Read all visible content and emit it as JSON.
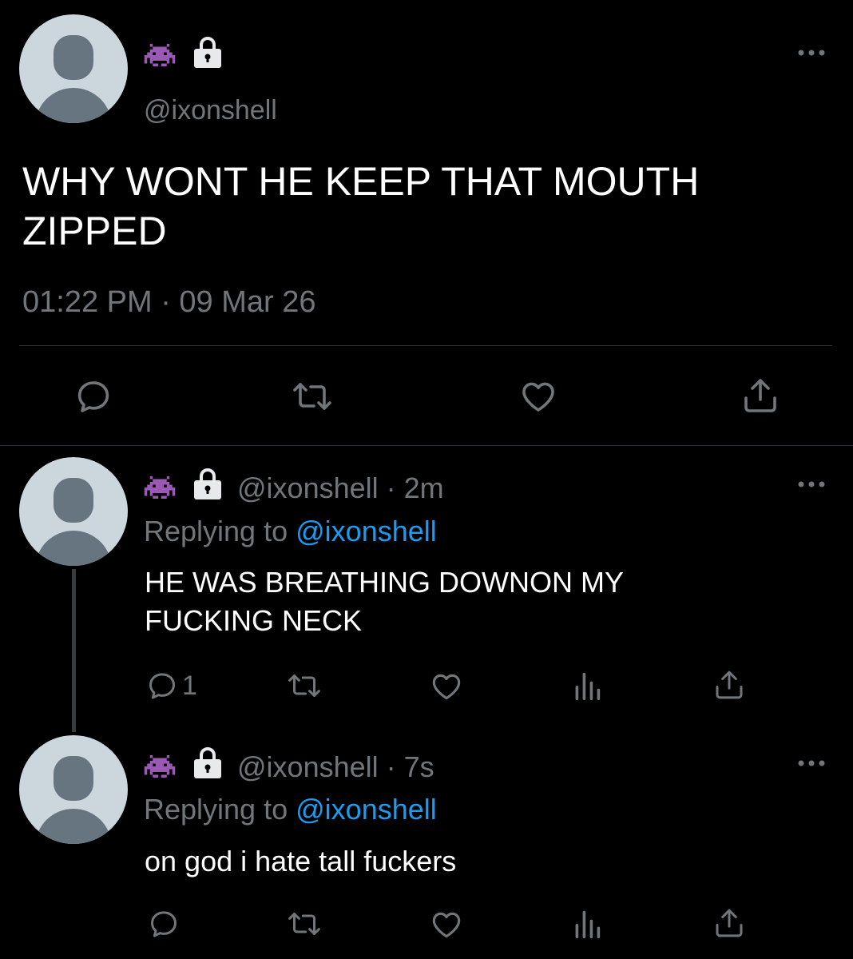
{
  "main_tweet": {
    "handle": "@ixonshell",
    "text_line1": "WHY WONT HE KEEP THAT MOUTH",
    "text_line2": "ZIPPED",
    "timestamp": "01:22 PM · 09 Mar 26"
  },
  "replies": [
    {
      "meta": "@ixonshell · 2m",
      "replying_label": "Replying to",
      "replying_handle": "@ixonshell",
      "text_line1": "HE WAS BREATHING DOWNON MY",
      "text_line2": "FUCKING NECK",
      "reply_count": "1"
    },
    {
      "meta": "@ixonshell · 7s",
      "replying_label": "Replying to",
      "replying_handle": "@ixonshell",
      "text_line1": "on god i hate tall fuckers"
    }
  ],
  "colors": {
    "background": "#000000",
    "text": "#e7e9ea",
    "muted": "#71767b",
    "link": "#1d9bf0",
    "divider": "#2f3336",
    "alien": "#9b59b6"
  },
  "icons": [
    "avatar-placeholder",
    "alien-emoji",
    "lock-icon",
    "more-icon",
    "reply-icon",
    "retweet-icon",
    "like-icon",
    "share-icon",
    "analytics-icon"
  ]
}
